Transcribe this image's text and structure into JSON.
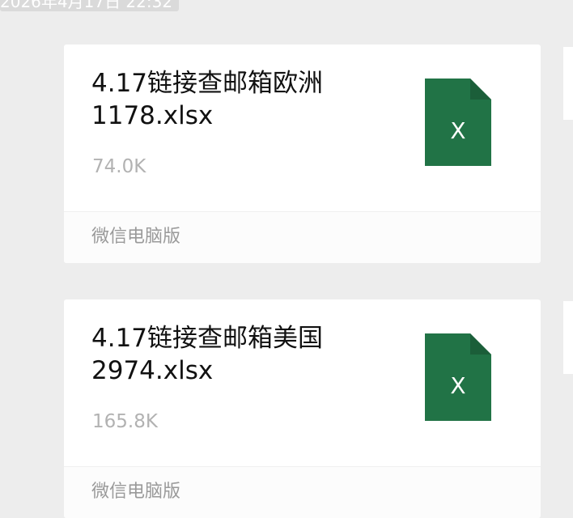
{
  "conversation": {
    "timestamp": "2026年4月17日 22:32",
    "messages": [
      {
        "file_name": "4.17链接查邮箱欧洲1178.xlsx",
        "file_size": "74.0K",
        "source": "微信电脑版",
        "icon": "excel-file-icon",
        "icon_letter": "X"
      },
      {
        "file_name": "4.17链接查邮箱美国2974.xlsx",
        "file_size": "165.8K",
        "source": "微信电脑版",
        "icon": "excel-file-icon",
        "icon_letter": "X"
      }
    ]
  },
  "colors": {
    "background": "#ededed",
    "card": "#ffffff",
    "excel_green": "#217346",
    "excel_fold": "#1b5e39",
    "size_gray": "#b2b2b2",
    "footer_gray": "#9a9a9a"
  }
}
